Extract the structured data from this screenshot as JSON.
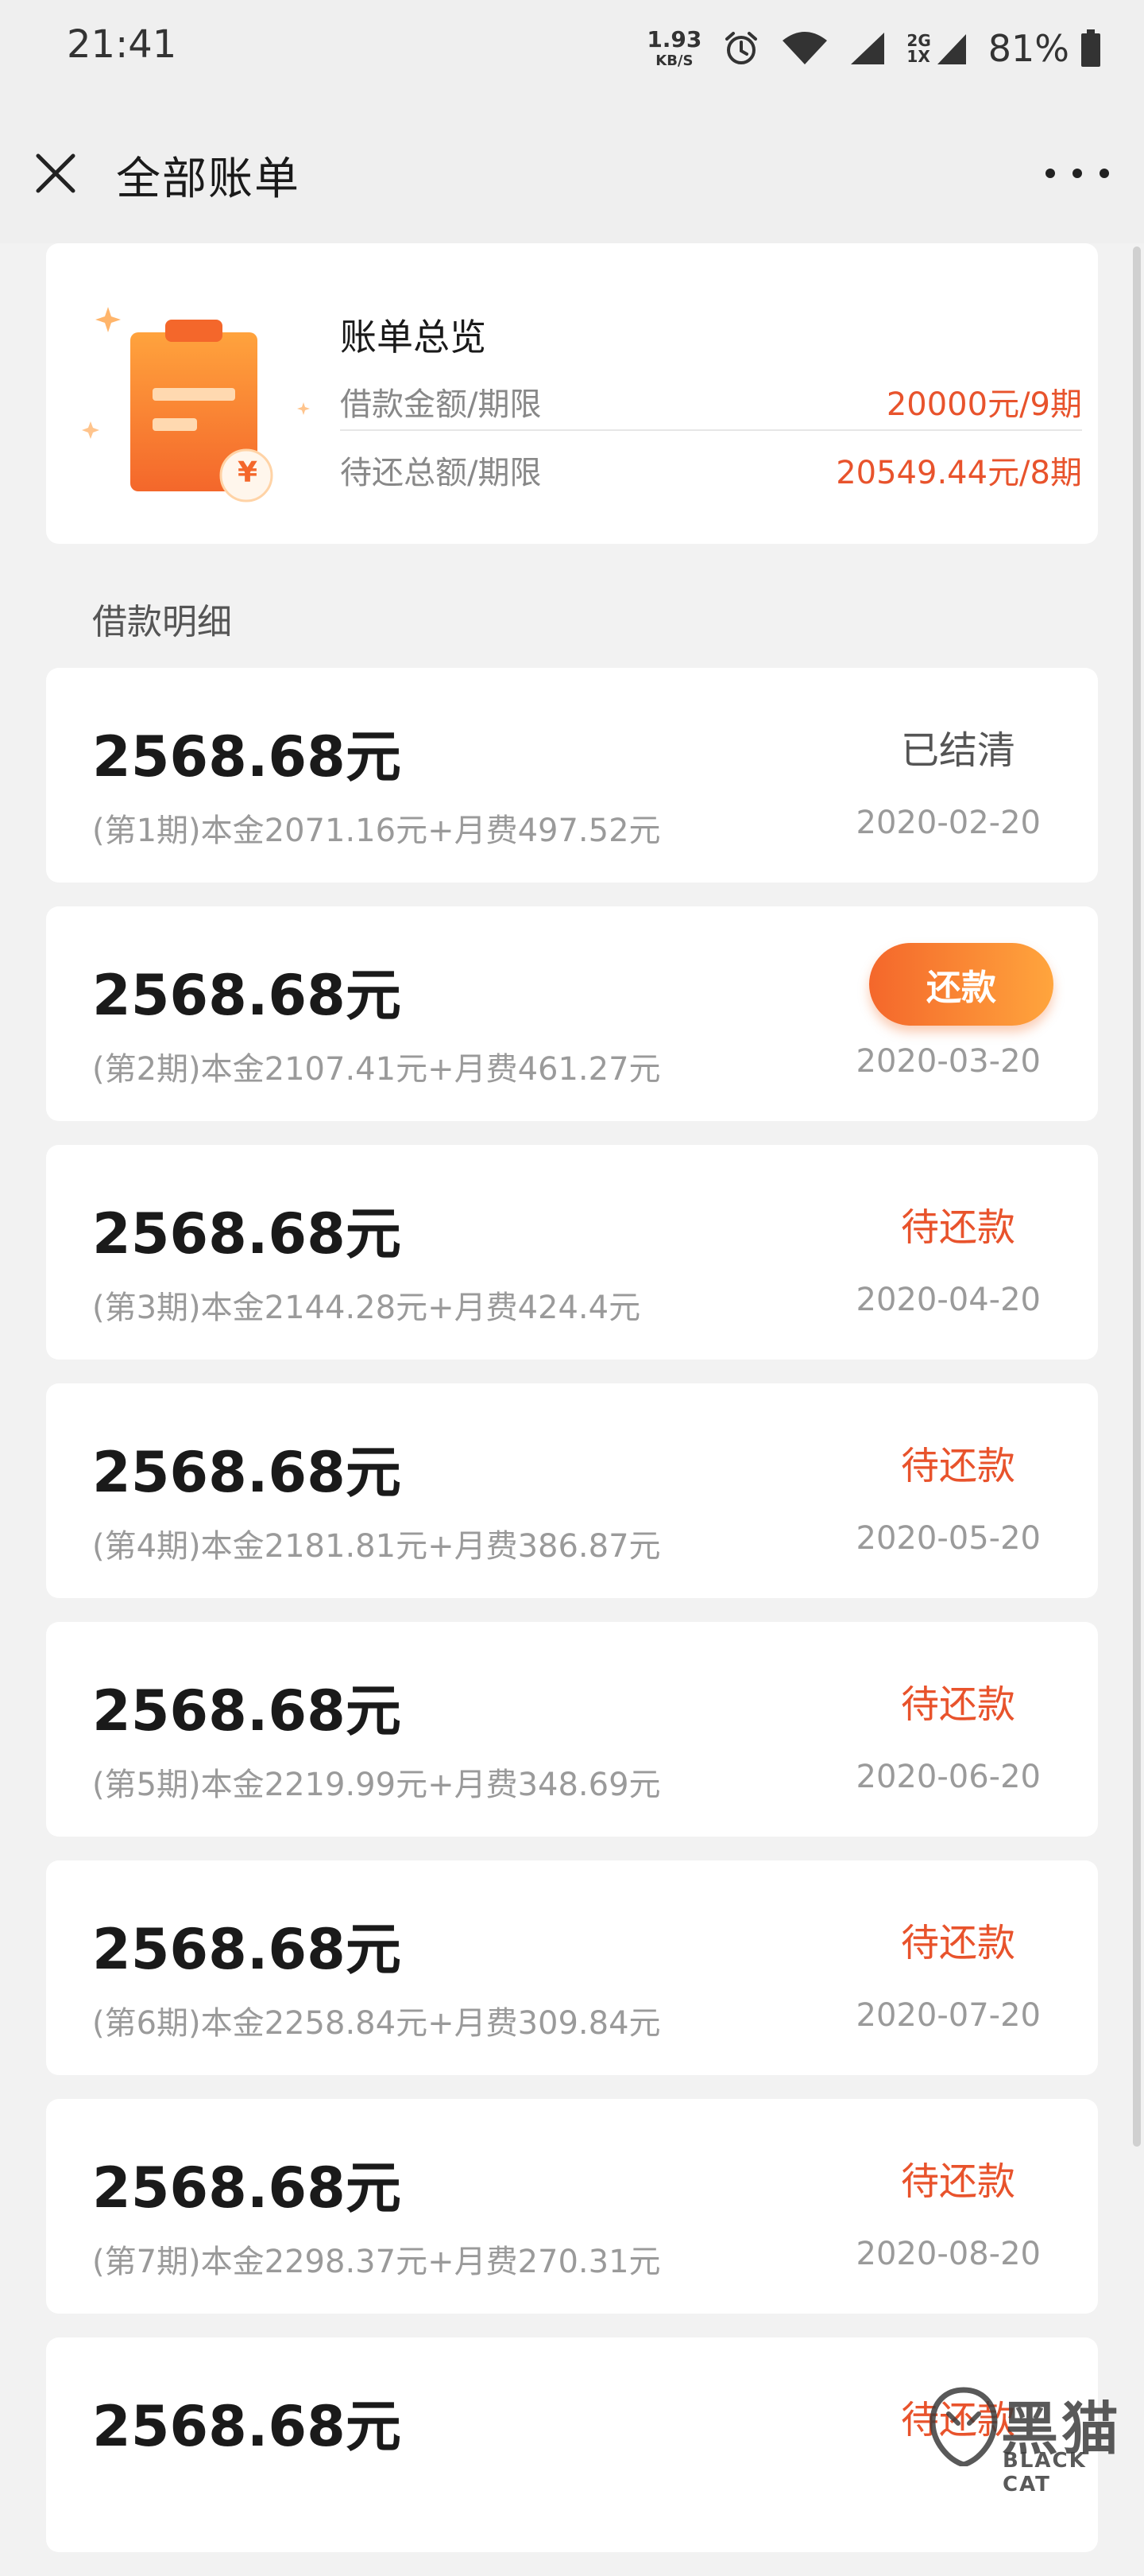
{
  "status_bar": {
    "time": "21:41",
    "net_speed_value": "1.93",
    "net_speed_unit": "KB/S",
    "network_type_top": "2G",
    "network_type_bottom": "1X",
    "battery": "81%",
    "icons": [
      "alarm-icon",
      "wifi-icon",
      "signal-icon",
      "signal-icon-2",
      "battery-icon"
    ]
  },
  "header": {
    "title": "全部账单",
    "close_icon": "close-icon",
    "more_icon": "more-icon"
  },
  "summary": {
    "title": "账单总览",
    "loan_label": "借款金额/期限",
    "loan_value": "20000元/9期",
    "pending_label": "待还总额/期限",
    "pending_value": "20549.44元/8期",
    "illustration": "clipboard-bill-icon",
    "illustration_symbol": "¥"
  },
  "section_title": "借款明细",
  "bills": [
    {
      "amount": "2568.68元",
      "detail": "(第1期)本金2071.16元+月费497.52元",
      "date": "2020-02-20",
      "status": "已结清",
      "status_type": "settled"
    },
    {
      "amount": "2568.68元",
      "detail": "(第2期)本金2107.41元+月费461.27元",
      "date": "2020-03-20",
      "status": "还款",
      "status_type": "button"
    },
    {
      "amount": "2568.68元",
      "detail": "(第3期)本金2144.28元+月费424.4元",
      "date": "2020-04-20",
      "status": "待还款",
      "status_type": "pending"
    },
    {
      "amount": "2568.68元",
      "detail": "(第4期)本金2181.81元+月费386.87元",
      "date": "2020-05-20",
      "status": "待还款",
      "status_type": "pending"
    },
    {
      "amount": "2568.68元",
      "detail": "(第5期)本金2219.99元+月费348.69元",
      "date": "2020-06-20",
      "status": "待还款",
      "status_type": "pending"
    },
    {
      "amount": "2568.68元",
      "detail": "(第6期)本金2258.84元+月费309.84元",
      "date": "2020-07-20",
      "status": "待还款",
      "status_type": "pending"
    },
    {
      "amount": "2568.68元",
      "detail": "(第7期)本金2298.37元+月费270.31元",
      "date": "2020-08-20",
      "status": "待还款",
      "status_type": "pending"
    },
    {
      "amount": "2568.68元",
      "detail": "",
      "date": "",
      "status": "待还款",
      "status_type": "pending"
    }
  ],
  "watermark": {
    "text_cn": "黑猫",
    "text_en": "BLACK CAT"
  },
  "colors": {
    "accent": "#e8532c",
    "button_gradient_start": "#f4672b",
    "button_gradient_end": "#ffa53d",
    "background": "#f2f2f2"
  }
}
